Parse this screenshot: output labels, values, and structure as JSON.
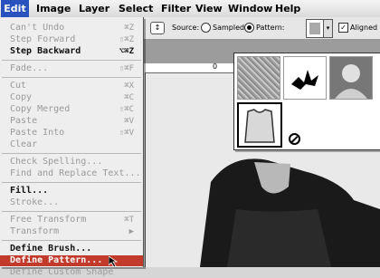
{
  "menubar": {
    "items": [
      {
        "label": "Edit",
        "active": true
      },
      {
        "label": "Image"
      },
      {
        "label": "Layer"
      },
      {
        "label": "Select"
      },
      {
        "label": "Filter"
      },
      {
        "label": "View"
      },
      {
        "label": "Window"
      },
      {
        "label": "Help"
      }
    ]
  },
  "options": {
    "source_label": "Source:",
    "sampled_label": "Sampled",
    "pattern_label": "Pattern:",
    "aligned_label": "Aligned",
    "ruler_zero": "0"
  },
  "edit_menu": {
    "items": [
      {
        "label": "Can't Undo",
        "shortcut": "⌘Z"
      },
      {
        "label": "Step Forward",
        "shortcut": "⇧⌘Z"
      },
      {
        "label": "Step Backward",
        "shortcut": "⌥⌘Z"
      },
      {
        "label": "Fade...",
        "shortcut": "⇧⌘F"
      },
      {
        "label": "Cut",
        "shortcut": "⌘X"
      },
      {
        "label": "Copy",
        "shortcut": "⌘C"
      },
      {
        "label": "Copy Merged",
        "shortcut": "⇧⌘C"
      },
      {
        "label": "Paste",
        "shortcut": "⌘V"
      },
      {
        "label": "Paste Into",
        "shortcut": "⇧⌘V"
      },
      {
        "label": "Clear",
        "shortcut": ""
      },
      {
        "label": "Check Spelling...",
        "shortcut": ""
      },
      {
        "label": "Find and Replace Text...",
        "shortcut": ""
      },
      {
        "label": "Fill...",
        "shortcut": ""
      },
      {
        "label": "Stroke...",
        "shortcut": ""
      },
      {
        "label": "Free Transform",
        "shortcut": "⌘T"
      },
      {
        "label": "Transform",
        "shortcut": "▶"
      },
      {
        "label": "Define Brush...",
        "shortcut": ""
      },
      {
        "label": "Define Pattern...",
        "shortcut": ""
      },
      {
        "label": "Define Custom Shape",
        "shortcut": ""
      }
    ]
  },
  "pattern_picker": {
    "swatches": [
      "noise-texture-pattern",
      "ink-splat-pattern",
      "portrait-pattern",
      "shirt-pattern"
    ]
  },
  "colors": {
    "menu_highlight": "#2a52be",
    "selection": "#c23a2c"
  }
}
